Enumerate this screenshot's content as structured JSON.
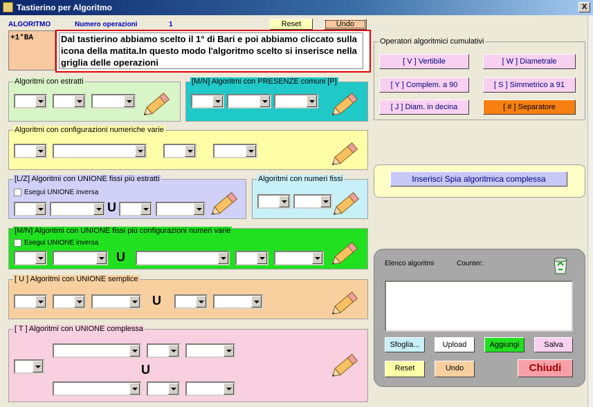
{
  "window": {
    "title": "Tastierino per Algoritmo",
    "close": "X"
  },
  "header": {
    "algoritmo_label": "ALGORITMO",
    "numero_label": "Numero operazioni",
    "numero_value": "1",
    "reset": "Reset",
    "undo": "Undo"
  },
  "algo_code": "+1°BA",
  "note": "Dal tastierino abbiamo scelto il 1° di Bari e poi abbiamo cliccato sulla icona della matita.In questo modo l'algoritmo scelto si inserisce nella griglia delle operazioni",
  "groups": {
    "estratti": "Algoritmi con estratti",
    "presenze": "[M/N] Algoritmi con PRESENZE comuni [P]",
    "config": "Algoritmi con configurazioni numeriche varie",
    "unione_fissi": "[L/Z] Algoritmi con UNIONE fissi più estratti",
    "unione_inversa": "Esegui UNIONE inversa",
    "numeri_fissi": "Algoritmi con numeri fissi",
    "unione_config": "[M/N] Algoritmi con UNIONE fissi più configurazioni numeri varie",
    "unione_inversa2": "Esegui UNIONE inversa",
    "unione_semplice": "[ U ] Algoritmi con UNIONE semplice",
    "unione_complessa": "[ T ] Algoritmi con UNIONE complessa",
    "u": "U"
  },
  "operatori": {
    "title": "Operatori algoritmici cumulativi",
    "v": "[ V ] Vertibile",
    "w": "[ W ] Diametrale",
    "y": "[ Y ] Complem. a 90",
    "s": "[ S ] Simmetrico  a 91",
    "j": "[ J ] Diam. in decina",
    "sep": "[ # ] Separatore"
  },
  "spia": "Inserisci Spia algoritmica complessa",
  "elenco": {
    "label": "Elenco algoritmi",
    "counter": "Counter:",
    "sfoglia": "Sfoglia...",
    "upload": "Upload",
    "aggiungi": "Aggiungi",
    "salva": "Salva",
    "reset": "Reset",
    "undo": "Undo",
    "chiudi": "Chiudi"
  },
  "colors": {
    "estratti": "#d8f5c8",
    "presenze": "#20c8c8",
    "config": "#ffffa8",
    "unione": "#d0d0f8",
    "fissi": "#c8f0f8",
    "verde": "#20e020",
    "arancio": "#f8d0a0",
    "rosa": "#f8d0e0"
  }
}
